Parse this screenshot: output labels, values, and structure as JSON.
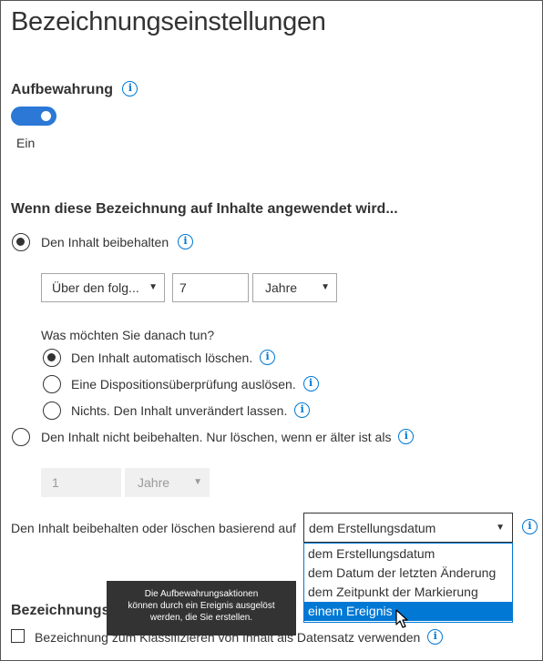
{
  "page": {
    "title": "Bezeichnungseinstellungen"
  },
  "retention": {
    "heading": "Aufbewahrung",
    "toggle_state": "on",
    "toggle_label": "Ein"
  },
  "when_applied": {
    "heading": "Wenn diese Bezeichnung auf Inhalte angewendet wird...",
    "keep_option": {
      "label": "Den Inhalt beibehalten",
      "selected": true
    },
    "period_select": "Über den folg...",
    "period_value": "7",
    "unit_select": "Jahre",
    "after_question": "Was möchten Sie danach tun?",
    "after_options": [
      {
        "label": "Den Inhalt automatisch löschen.",
        "selected": true
      },
      {
        "label": "Eine Dispositionsüberprüfung auslösen.",
        "selected": false
      },
      {
        "label": "Nichts. Den Inhalt unverändert lassen.",
        "selected": false
      }
    ],
    "dont_keep_option": {
      "label": "Den Inhalt nicht beibehalten. Nur löschen, wenn er älter ist als",
      "selected": false
    },
    "disabled_value": "1",
    "disabled_unit": "Jahre"
  },
  "based_on": {
    "label": "Den Inhalt beibehalten oder löschen basierend auf",
    "selected": "dem Erstellungsdatum",
    "options": [
      "dem Erstellungsdatum",
      "dem Datum der letzten Änderung",
      "dem Zeitpunkt der Markierung",
      "einem Ereignis"
    ],
    "highlighted_index": 3
  },
  "tooltip": {
    "lines": [
      "Die Aufbewahrungsaktionen",
      "können durch ein Ereignis ausgelöst",
      "werden, die Sie erstellen."
    ]
  },
  "label_section": {
    "heading_partial": "Bezeichnungsb",
    "checkbox_label": "Bezeichnung zum Klassifizieren von Inhalt als Datensatz verwenden",
    "checked": false
  },
  "icons": {
    "info": "i",
    "caret": "▼",
    "cursor": "mouse-pointer-icon"
  },
  "colors": {
    "accent": "#0078d4",
    "toggle_on": "#2b78d6",
    "tooltip_bg": "#333333"
  }
}
